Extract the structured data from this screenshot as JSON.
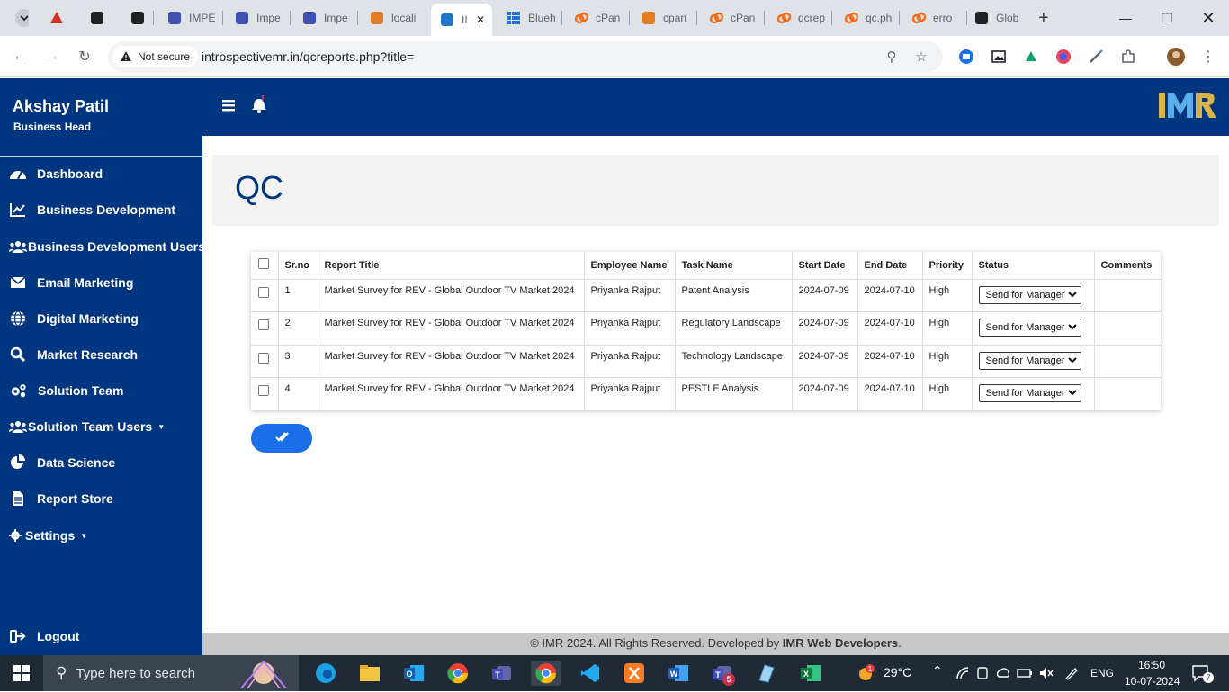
{
  "browser": {
    "tabs": [
      {
        "label": "",
        "icon": "chevron-down-icon"
      },
      {
        "label": "",
        "icon": "triangle-icon"
      },
      {
        "label": "",
        "icon": "openai-icon"
      },
      {
        "label": "",
        "icon": "tv-icon"
      },
      {
        "label": "IMPE",
        "icon": "impe-icon"
      },
      {
        "label": "Impe",
        "icon": "impe-icon"
      },
      {
        "label": "Impe",
        "icon": "impe-icon"
      },
      {
        "label": "locali",
        "icon": "pma-icon"
      },
      {
        "label": "II",
        "icon": "imr-icon"
      },
      {
        "label": "Blueh",
        "icon": "grid-icon"
      },
      {
        "label": "cPan",
        "icon": "cpanel-icon"
      },
      {
        "label": "cpan",
        "icon": "pma-icon"
      },
      {
        "label": "cPan",
        "icon": "cpanel-icon"
      },
      {
        "label": "qcrep",
        "icon": "cpanel-icon"
      },
      {
        "label": "qc.ph",
        "icon": "cpanel-icon"
      },
      {
        "label": "erro",
        "icon": "cpanel-icon"
      },
      {
        "label": "Glob",
        "icon": "cvi-icon"
      }
    ],
    "security_label": "Not secure",
    "url": "introspectivemr.in/qcreports.php?title="
  },
  "user": {
    "name": "Akshay Patil",
    "role": "Business Head"
  },
  "sidebar": {
    "items": [
      {
        "label": "Dashboard",
        "icon": "dashboard-gauge-icon",
        "has_caret": false
      },
      {
        "label": "Business Development",
        "icon": "chart-line-icon",
        "has_caret": false
      },
      {
        "label": "Business Development Users",
        "icon": "users-icon",
        "has_caret": true
      },
      {
        "label": "Email Marketing",
        "icon": "envelope-icon",
        "has_caret": false
      },
      {
        "label": "Digital Marketing",
        "icon": "globe-icon",
        "has_caret": false
      },
      {
        "label": "Market Research",
        "icon": "search-icon",
        "has_caret": false
      },
      {
        "label": "Solution Team",
        "icon": "cogs-icon",
        "has_caret": false
      },
      {
        "label": "Solution Team Users",
        "icon": "users-icon",
        "has_caret": true
      },
      {
        "label": "Data Science",
        "icon": "pie-chart-icon",
        "has_caret": false
      },
      {
        "label": "Report Store",
        "icon": "file-icon",
        "has_caret": false
      },
      {
        "label": "Settings",
        "icon": "gear-icon",
        "has_caret": true
      }
    ],
    "logout_label": "Logout"
  },
  "page": {
    "title": "QC"
  },
  "table": {
    "headers": [
      "Sr.no",
      "Report Title",
      "Employee Name",
      "Task Name",
      "Start Date",
      "End Date",
      "Priority",
      "Status",
      "Comments"
    ],
    "rows": [
      {
        "srno": "1",
        "report_title": "Market Survey for REV - Global Outdoor TV Market 2024",
        "employee": "Priyanka Rajput",
        "task": "Patent Analysis",
        "start": "2024-07-09",
        "end": "2024-07-10",
        "priority": "High",
        "status": "Send for Manager",
        "comments": ""
      },
      {
        "srno": "2",
        "report_title": "Market Survey for REV - Global Outdoor TV Market 2024",
        "employee": "Priyanka Rajput",
        "task": "Regulatory Landscape",
        "start": "2024-07-09",
        "end": "2024-07-10",
        "priority": "High",
        "status": "Send for Manager",
        "comments": ""
      },
      {
        "srno": "3",
        "report_title": "Market Survey for REV - Global Outdoor TV Market 2024",
        "employee": "Priyanka Rajput",
        "task": "Technology Landscape",
        "start": "2024-07-09",
        "end": "2024-07-10",
        "priority": "High",
        "status": "Send for Manager",
        "comments": ""
      },
      {
        "srno": "4",
        "report_title": "Market Survey for REV - Global Outdoor TV Market 2024",
        "employee": "Priyanka Rajput",
        "task": "PESTLE Analysis",
        "start": "2024-07-09",
        "end": "2024-07-10",
        "priority": "High",
        "status": "Send for Manager",
        "comments": ""
      }
    ]
  },
  "footer": {
    "prefix": "© IMR 2024. All Rights Reserved. Developed by ",
    "developer": "IMR Web Developers",
    "suffix": "."
  },
  "taskbar": {
    "search_placeholder": "Type here to search",
    "weather": "29°C",
    "language": "ENG",
    "time": "16:50",
    "date": "10-07-2024",
    "notification_count": "7",
    "teams_badge": "5"
  },
  "colors": {
    "brand_navy": "#003580",
    "button_blue": "#1a6fe8"
  }
}
